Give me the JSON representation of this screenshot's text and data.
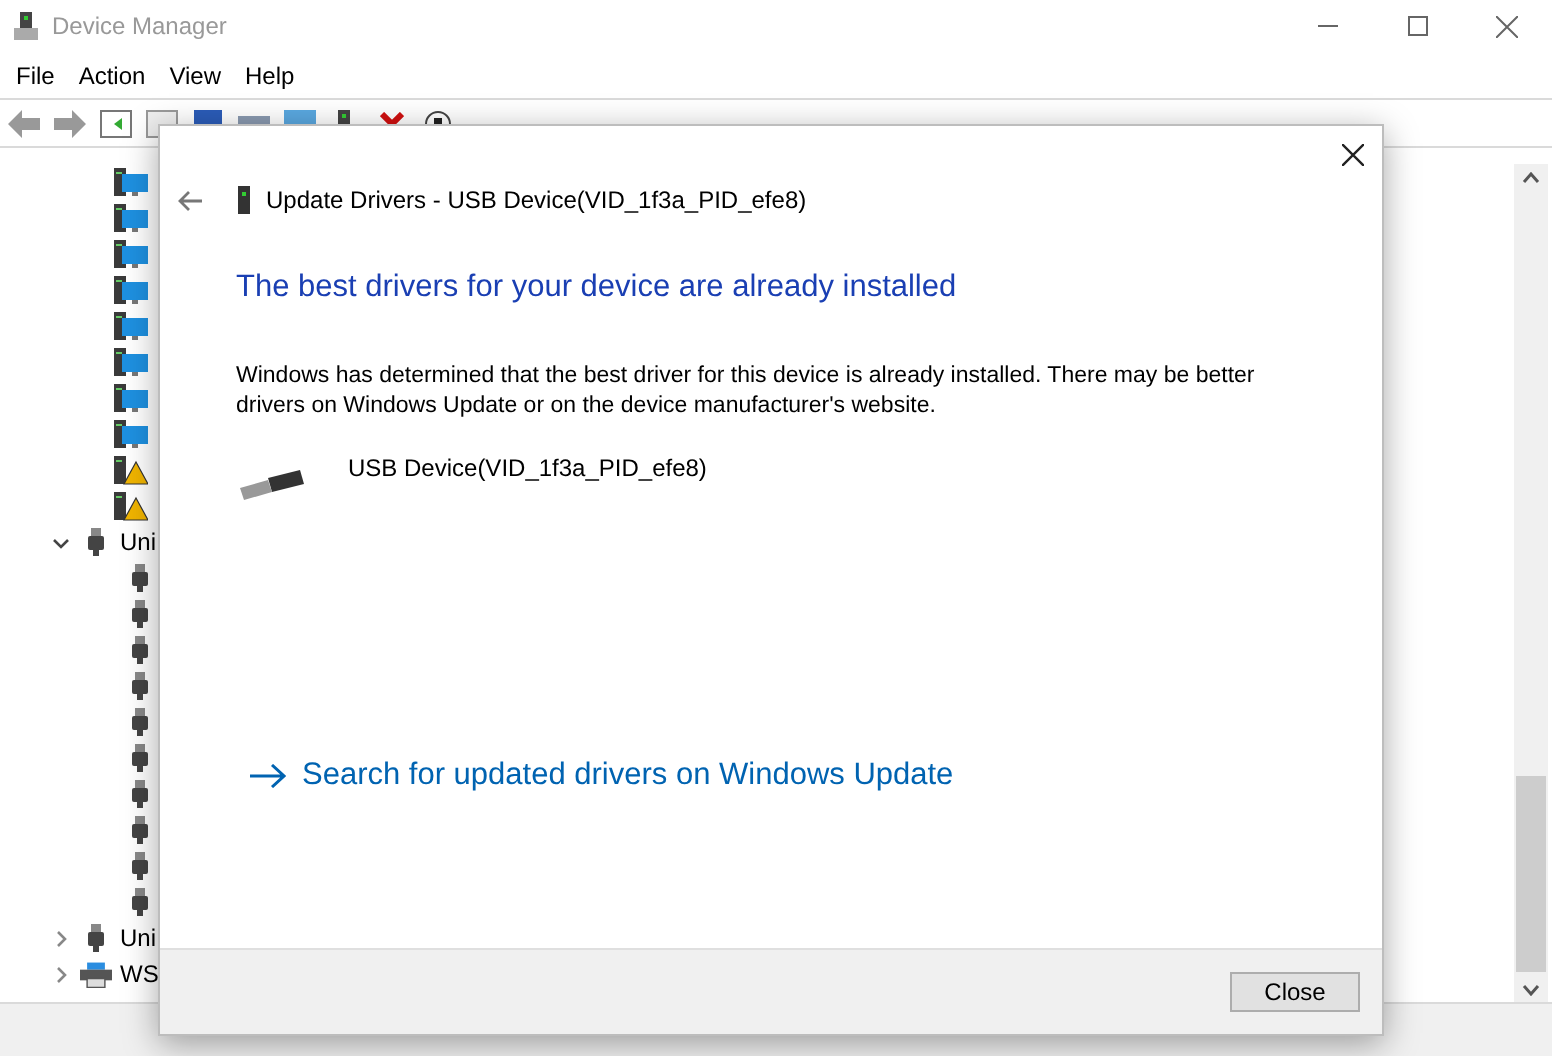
{
  "window": {
    "title": "Device Manager"
  },
  "menu": [
    "File",
    "Action",
    "View",
    "Help"
  ],
  "tree": [
    {
      "kind": "monitor"
    },
    {
      "kind": "monitor"
    },
    {
      "kind": "monitor"
    },
    {
      "kind": "monitor"
    },
    {
      "kind": "monitor"
    },
    {
      "kind": "monitor"
    },
    {
      "kind": "monitor"
    },
    {
      "kind": "monitor"
    },
    {
      "kind": "monitor-warning"
    },
    {
      "kind": "monitor-warning"
    },
    {
      "kind": "usb",
      "label": "Uni",
      "expanded": true,
      "children": [
        {
          "kind": "usb"
        },
        {
          "kind": "usb"
        },
        {
          "kind": "usb"
        },
        {
          "kind": "usb"
        },
        {
          "kind": "usb"
        },
        {
          "kind": "usb"
        },
        {
          "kind": "usb"
        },
        {
          "kind": "usb"
        },
        {
          "kind": "usb"
        },
        {
          "kind": "usb"
        }
      ]
    },
    {
      "kind": "usb",
      "label": "Uni",
      "expanded": false
    },
    {
      "kind": "printer",
      "label": "WS",
      "expanded": false
    }
  ],
  "dialog": {
    "title": "Update Drivers - USB Device(VID_1f3a_PID_efe8)",
    "heading": "The best drivers for your device are already installed",
    "message": "Windows has determined that the best driver for this device is already installed. There may be better drivers on Windows Update or on the device manufacturer's website.",
    "device": "USB Device(VID_1f3a_PID_efe8)",
    "link": "Search for updated drivers on Windows Update",
    "button": "Close"
  }
}
